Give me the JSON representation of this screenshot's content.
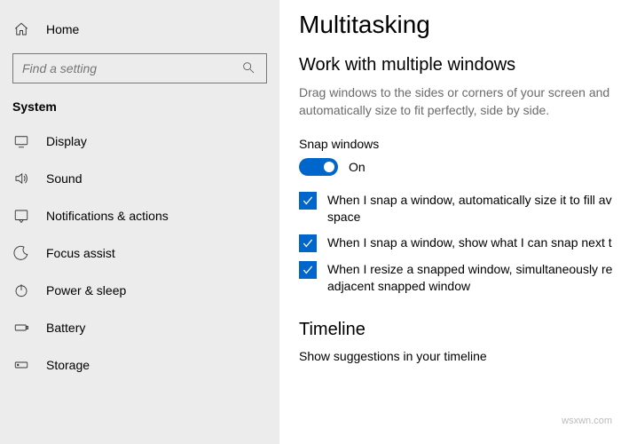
{
  "sidebar": {
    "home_label": "Home",
    "search_placeholder": "Find a setting",
    "section_label": "System",
    "items": [
      {
        "label": "Display"
      },
      {
        "label": "Sound"
      },
      {
        "label": "Notifications & actions"
      },
      {
        "label": "Focus assist"
      },
      {
        "label": "Power & sleep"
      },
      {
        "label": "Battery"
      },
      {
        "label": "Storage"
      }
    ]
  },
  "main": {
    "title": "Multitasking",
    "section1_heading": "Work with multiple windows",
    "section1_desc": "Drag windows to the sides or corners of your screen and automatically size to fit perfectly, side by side.",
    "snap_label": "Snap windows",
    "snap_state": "On",
    "checks": [
      "When I snap a window, automatically size it to fill av space",
      "When I snap a window, show what I can snap next t",
      "When I resize a snapped window, simultaneously re adjacent snapped window"
    ],
    "timeline_heading": "Timeline",
    "timeline_sub": "Show suggestions in your timeline"
  },
  "watermark": "wsxwn.com"
}
